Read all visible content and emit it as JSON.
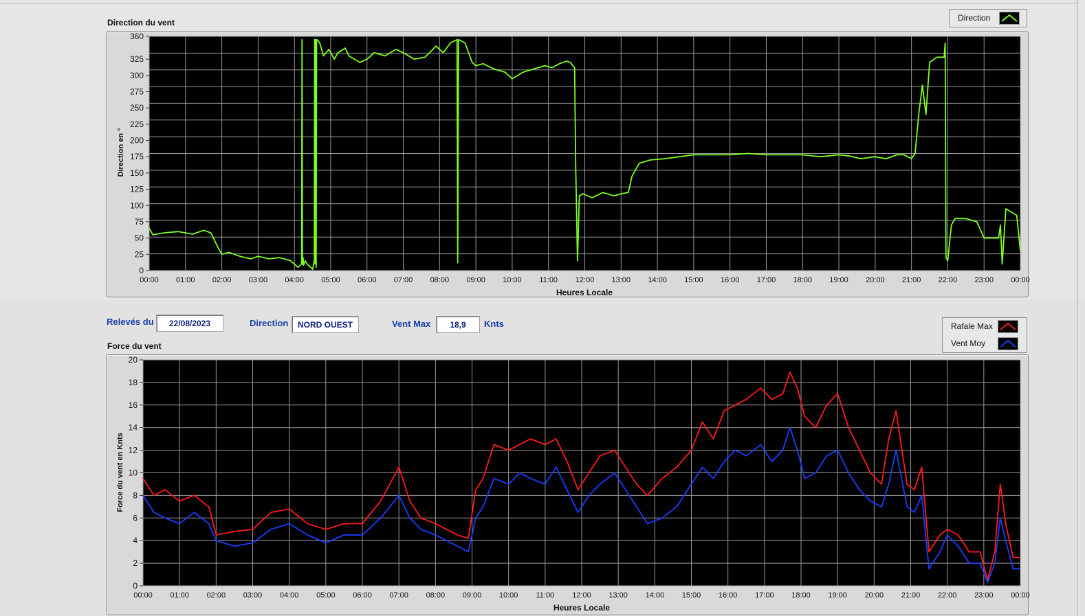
{
  "direction_chart": {
    "title": "Direction du vent",
    "legend_label": "Direction",
    "ylabel": "Direction en °",
    "xlabel": "Heures Locale",
    "color": "#7fff1a"
  },
  "controls": {
    "date_label": "Relevés du",
    "date_value": "22/08/2023",
    "direction_label": "Direction",
    "direction_value": "NORD OUEST",
    "ventmax_label": "Vent Max",
    "ventmax_value": "18,9",
    "ventmax_unit": "Knts"
  },
  "force_chart": {
    "title": "Force du vent",
    "legend_gust": "Rafale Max",
    "legend_avg": "Vent Moy",
    "ylabel": "Force du vent en Knts",
    "xlabel": "Heures Locale",
    "gust_color": "#ff1a1a",
    "avg_color": "#1a3dff"
  },
  "chart_data": [
    {
      "type": "line",
      "title": "Direction du vent",
      "xlabel": "Heures Locale",
      "ylabel": "Direction en °",
      "xlim": [
        0,
        24
      ],
      "ylim": [
        0,
        360
      ],
      "x_ticks": [
        "00:00",
        "01:00",
        "02:00",
        "03:00",
        "04:00",
        "05:00",
        "06:00",
        "07:00",
        "08:00",
        "09:00",
        "10:00",
        "11:00",
        "12:00",
        "13:00",
        "14:00",
        "15:00",
        "16:00",
        "17:00",
        "18:00",
        "19:00",
        "20:00",
        "21:00",
        "22:00",
        "23:00",
        "00:00"
      ],
      "y_ticks": [
        0,
        25,
        50,
        75,
        100,
        125,
        150,
        175,
        200,
        225,
        250,
        275,
        300,
        325,
        360
      ],
      "grid": true,
      "legend_position": "top-right",
      "series": [
        {
          "name": "Direction",
          "color": "#7fff1a",
          "x": [
            0,
            0.1,
            0.4,
            0.8,
            1.2,
            1.5,
            1.7,
            1.9,
            2.0,
            2.2,
            2.5,
            2.8,
            3.0,
            3.3,
            3.6,
            3.9,
            4.1,
            4.2,
            4.21,
            4.22,
            4.24,
            4.25,
            4.3,
            4.35,
            4.45,
            4.5,
            4.55,
            4.56,
            4.57,
            4.58,
            4.6,
            4.61,
            4.62,
            4.7,
            4.8,
            4.95,
            5.1,
            5.2,
            5.4,
            5.5,
            5.8,
            6.0,
            6.2,
            6.5,
            6.8,
            7.0,
            7.3,
            7.6,
            7.9,
            8.1,
            8.3,
            8.48,
            8.5,
            8.52,
            8.7,
            8.9,
            9.0,
            9.2,
            9.5,
            9.8,
            10.0,
            10.3,
            10.6,
            10.9,
            11.1,
            11.3,
            11.5,
            11.6,
            11.72,
            11.75,
            11.8,
            11.85,
            11.95,
            12.2,
            12.5,
            12.8,
            13.0,
            13.2,
            13.3,
            13.5,
            13.8,
            14.2,
            14.6,
            15.0,
            15.5,
            16.0,
            16.5,
            17.0,
            17.5,
            18.0,
            18.5,
            19.0,
            19.3,
            19.6,
            20.0,
            20.3,
            20.6,
            20.8,
            21.0,
            21.1,
            21.2,
            21.3,
            21.4,
            21.5,
            21.7,
            21.9,
            21.93,
            21.95,
            22.0,
            22.1,
            22.2,
            22.5,
            22.8,
            23.0,
            23.4,
            23.45,
            23.5,
            23.6,
            23.9,
            24.0
          ],
          "y": [
            65,
            55,
            58,
            60,
            56,
            62,
            58,
            35,
            25,
            28,
            22,
            18,
            22,
            18,
            20,
            15,
            5,
            10,
            355,
            10,
            20,
            8,
            15,
            10,
            5,
            2,
            15,
            355,
            10,
            355,
            5,
            355,
            355,
            350,
            330,
            340,
            325,
            335,
            342,
            330,
            320,
            325,
            335,
            330,
            340,
            335,
            325,
            328,
            345,
            335,
            350,
            355,
            12,
            355,
            350,
            320,
            315,
            318,
            310,
            305,
            295,
            305,
            310,
            315,
            312,
            318,
            322,
            320,
            312,
            160,
            15,
            115,
            118,
            112,
            120,
            115,
            118,
            120,
            145,
            165,
            170,
            172,
            175,
            178,
            178,
            178,
            180,
            178,
            178,
            178,
            175,
            178,
            176,
            172,
            175,
            172,
            178,
            178,
            172,
            180,
            240,
            285,
            240,
            320,
            328,
            328,
            350,
            20,
            15,
            70,
            80,
            80,
            75,
            50,
            50,
            70,
            10,
            95,
            85,
            30
          ]
        }
      ]
    },
    {
      "type": "line",
      "title": "Force du vent",
      "xlabel": "Heures Locale",
      "ylabel": "Force du vent en Knts",
      "xlim": [
        0,
        24
      ],
      "ylim": [
        0,
        20
      ],
      "x_ticks": [
        "00:00",
        "01:00",
        "02:00",
        "03:00",
        "04:00",
        "05:00",
        "06:00",
        "07:00",
        "08:00",
        "09:00",
        "10:00",
        "11:00",
        "12:00",
        "13:00",
        "14:00",
        "15:00",
        "16:00",
        "17:00",
        "18:00",
        "19:00",
        "20:00",
        "21:00",
        "22:00",
        "23:00",
        "00:00"
      ],
      "y_ticks": [
        0,
        2,
        4,
        6,
        8,
        10,
        12,
        14,
        16,
        18,
        20
      ],
      "grid": true,
      "legend_position": "top-right",
      "series": [
        {
          "name": "Rafale Max",
          "color": "#ff1a1a",
          "x": [
            0,
            0.3,
            0.6,
            1.0,
            1.4,
            1.8,
            2.0,
            2.5,
            3.0,
            3.5,
            4.0,
            4.5,
            5.0,
            5.5,
            6.0,
            6.5,
            7.0,
            7.3,
            7.6,
            8.0,
            8.3,
            8.6,
            8.9,
            9.1,
            9.3,
            9.6,
            10.0,
            10.3,
            10.6,
            11.0,
            11.3,
            11.6,
            11.9,
            12.2,
            12.5,
            12.9,
            13.2,
            13.5,
            13.8,
            14.2,
            14.6,
            15.0,
            15.3,
            15.6,
            15.9,
            16.2,
            16.5,
            16.9,
            17.2,
            17.5,
            17.7,
            17.9,
            18.1,
            18.4,
            18.7,
            19.0,
            19.3,
            19.6,
            19.9,
            20.2,
            20.4,
            20.6,
            20.9,
            21.1,
            21.3,
            21.5,
            21.8,
            22.0,
            22.3,
            22.6,
            22.9,
            23.1,
            23.3,
            23.45,
            23.6,
            23.8,
            24.0
          ],
          "y": [
            9.5,
            8.0,
            8.5,
            7.5,
            8.0,
            7.0,
            4.5,
            4.8,
            5.0,
            6.5,
            6.8,
            5.5,
            5.0,
            5.5,
            5.5,
            7.5,
            10.5,
            7.5,
            6.0,
            5.5,
            5.0,
            4.5,
            4.2,
            8.5,
            9.5,
            12.5,
            12.0,
            12.5,
            13.0,
            12.5,
            13.0,
            11.0,
            8.5,
            10.0,
            11.5,
            12.0,
            10.5,
            9.0,
            8.0,
            9.5,
            10.5,
            12.0,
            14.5,
            13.0,
            15.5,
            16.0,
            16.5,
            17.5,
            16.5,
            17.0,
            18.9,
            17.5,
            15.0,
            14.0,
            16.0,
            17.0,
            14.0,
            12.0,
            10.0,
            9.0,
            13.0,
            15.5,
            9.0,
            8.5,
            10.5,
            3.0,
            4.5,
            5.0,
            4.5,
            3.0,
            3.0,
            0.5,
            3.0,
            9.0,
            5.5,
            2.5,
            2.5
          ]
        },
        {
          "name": "Vent Moy",
          "color": "#1a3dff",
          "x": [
            0,
            0.3,
            0.6,
            1.0,
            1.4,
            1.8,
            2.0,
            2.5,
            3.0,
            3.5,
            4.0,
            4.5,
            5.0,
            5.5,
            6.0,
            6.5,
            7.0,
            7.3,
            7.6,
            8.0,
            8.3,
            8.6,
            8.9,
            9.1,
            9.3,
            9.6,
            10.0,
            10.3,
            10.6,
            11.0,
            11.3,
            11.6,
            11.9,
            12.2,
            12.5,
            12.9,
            13.2,
            13.5,
            13.8,
            14.2,
            14.6,
            15.0,
            15.3,
            15.6,
            15.9,
            16.2,
            16.5,
            16.9,
            17.2,
            17.5,
            17.7,
            17.9,
            18.1,
            18.4,
            18.7,
            19.0,
            19.3,
            19.6,
            19.9,
            20.2,
            20.4,
            20.6,
            20.9,
            21.1,
            21.3,
            21.5,
            21.8,
            22.0,
            22.3,
            22.6,
            22.9,
            23.1,
            23.3,
            23.45,
            23.6,
            23.8,
            24.0
          ],
          "y": [
            8.0,
            6.5,
            6.0,
            5.5,
            6.5,
            5.5,
            4.0,
            3.5,
            3.8,
            5.0,
            5.5,
            4.5,
            3.8,
            4.5,
            4.5,
            6.0,
            8.0,
            6.0,
            5.0,
            4.5,
            4.0,
            3.5,
            3.0,
            6.0,
            7.0,
            9.5,
            9.0,
            10.0,
            9.5,
            9.0,
            10.5,
            8.5,
            6.5,
            8.0,
            9.0,
            10.0,
            8.5,
            7.0,
            5.5,
            6.0,
            7.0,
            9.0,
            10.5,
            9.5,
            11.0,
            12.0,
            11.5,
            12.5,
            11.0,
            12.0,
            14.0,
            12.0,
            9.5,
            10.0,
            11.5,
            12.0,
            10.0,
            8.5,
            7.5,
            7.0,
            9.0,
            12.0,
            7.0,
            6.5,
            8.0,
            1.5,
            3.0,
            4.5,
            3.5,
            2.0,
            2.0,
            0.3,
            2.0,
            6.0,
            4.0,
            1.5,
            1.5
          ]
        }
      ]
    }
  ]
}
